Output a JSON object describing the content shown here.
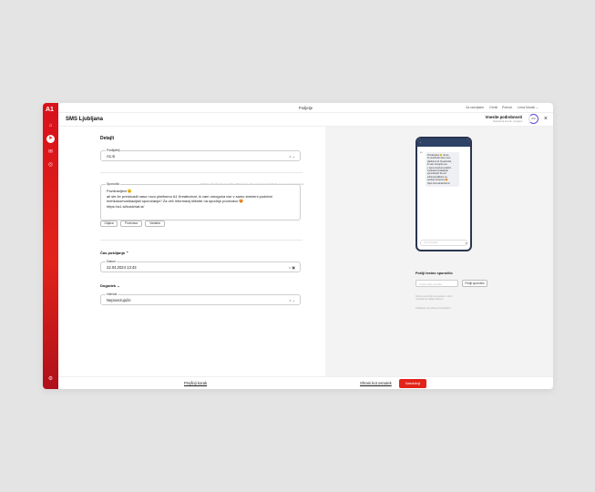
{
  "topbar": {
    "title": "Podjetje",
    "links": [
      "Za razvijalce",
      "Cenik",
      "Pomoč",
      "Lena Novak ⌄"
    ]
  },
  "header": {
    "page_title": "SMS Ljubljana",
    "progress_label": "Vnesite podrobnosti",
    "progress_sub": "Naslednji korak: pregled",
    "progress_ring": "2/3",
    "close": "×"
  },
  "rail": {
    "logo": "A1"
  },
  "details": {
    "title": "Detajli",
    "sender_label": "Pošiljatelj",
    "sender_value": "A1.si",
    "message_label": "Sporočilo",
    "message_hint": "Dolžina: 2/3. Število sporočil je 252 znakov. Za več informacij kliknite na vnos na A1.kosova",
    "message_text": "Pozdravljeni 😊\nali ste že preizkusili naso novo platformo A1 Kreativchat, ki vam omogoča vse v samo streženi podobni mehkokomunikacijski sporočanja? Za več informacij kliknite na spodnjo povezavo 😍\nhttps://a1.si/kosichat.si/",
    "chips": [
      "Odjava",
      "Povezava",
      "Variabla"
    ]
  },
  "schedule": {
    "title": "Čas pošiljanja ⌃",
    "date_label": "Datum",
    "date_value": "22.04.2024 13:43"
  },
  "event": {
    "title": "Dogodek ⌄",
    "interval_label": "Interval",
    "interval_value": "Nepovezujoče"
  },
  "preview": {
    "bubble_text": "Pozdravljeni 😊 ali ste\nže preizkusili naso novo\nplatformo A1 Kreativchat,\nki vam omogoča vse\nv samo streženi podobni\nmehkokomunikacijski\nsporočanja? Za več\ninformacij kliknite na\nspodnjo povezavo 😍\nhttps://a1.si/kosichat.si/",
    "bubble_sender": "A1",
    "input_placeholder": "Vnos besedila",
    "test_title": "Pošlji testno sporočilo",
    "test_placeholder": "Telefonska številka",
    "test_button": "Pošlji sporočilo",
    "note1": "Testno sporočilo bo poslano v dveh\nminutah po oddaji zahteve.",
    "note2": "Pošiljanje sporočila je brezplačno."
  },
  "footer": {
    "previous": "Prejšnji korak",
    "save_draft": "Shrani kot osnutek",
    "next": "Naslednji"
  }
}
